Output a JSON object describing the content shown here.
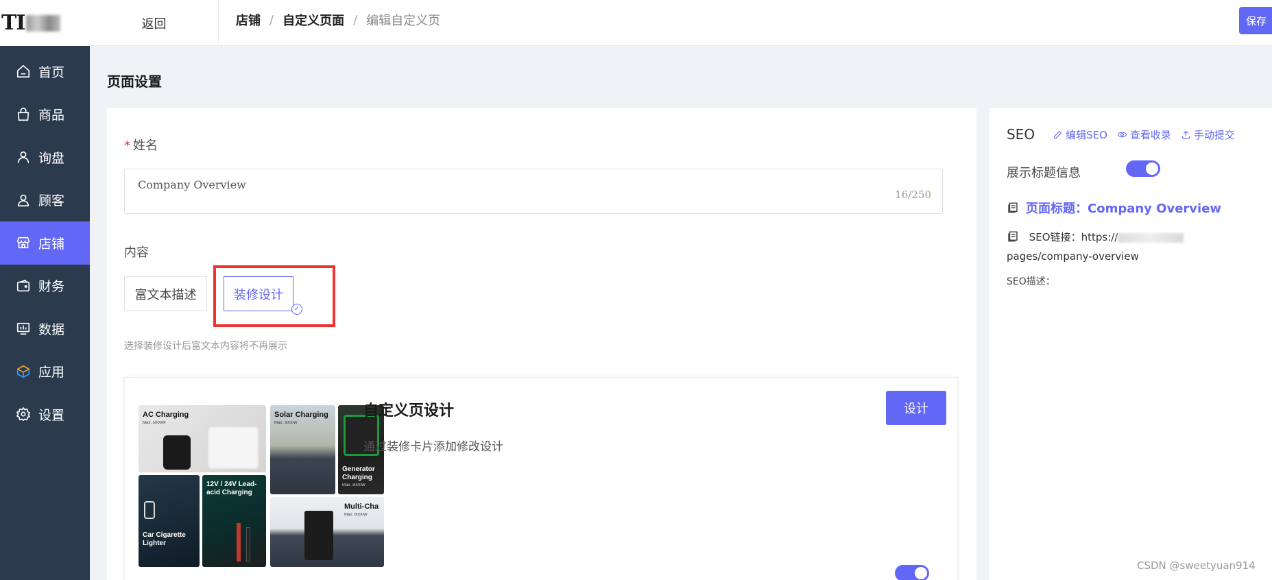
{
  "logo": {
    "text": "TI"
  },
  "nav": {
    "items": [
      {
        "label": "首页",
        "icon": "home-icon"
      },
      {
        "label": "商品",
        "icon": "shopping-bag-icon"
      },
      {
        "label": "询盘",
        "icon": "user-icon"
      },
      {
        "label": "顾客",
        "icon": "customer-icon"
      },
      {
        "label": "店铺",
        "icon": "store-icon",
        "active": true
      },
      {
        "label": "财务",
        "icon": "wallet-icon"
      },
      {
        "label": "数据",
        "icon": "monitor-chart-icon"
      },
      {
        "label": "应用",
        "icon": "cube-icon"
      },
      {
        "label": "设置",
        "icon": "gear-icon"
      }
    ]
  },
  "topbar": {
    "back_label": "返回",
    "breadcrumb": [
      "店铺",
      "自定义页面",
      "编辑自定义页"
    ],
    "save_label": "保存"
  },
  "page": {
    "title": "页面设置"
  },
  "form": {
    "name_label": "姓名",
    "name_value": "Company Overview",
    "name_count": "16/250",
    "content_label": "内容",
    "option_rich_text": "富文本描述",
    "option_design": "装修设计",
    "hint": "选择装修设计后富文本内容将不再展示"
  },
  "design_card": {
    "title": "自定义页设计",
    "description": "通过装修卡片添加修改设计",
    "design_button": "设计",
    "enabled": true,
    "tiles": {
      "ac": {
        "title": "AC Charging",
        "sub": "Max. 5000W"
      },
      "solar": {
        "title": "Solar Charging",
        "sub": "Max. 3000W"
      },
      "generator": {
        "title": "Generator Charging",
        "sub": "Max. 3000W"
      },
      "car": {
        "title": "Car Cigarette Lighter"
      },
      "lead": {
        "title": "12V / 24V Lead-acid Charging"
      },
      "multi": {
        "title": "Multi-Cha",
        "sub": "Max. 8000W"
      }
    }
  },
  "seo": {
    "title": "SEO",
    "edit_label": "编辑SEO",
    "view_label": "查看收录",
    "submit_label": "手动提交",
    "show_title_label": "展示标题信息",
    "show_title_enabled": true,
    "page_title_label": "页面标题：Company Overview",
    "url_prefix": "SEO链接：https://",
    "url_suffix": "pages/company-overview",
    "desc_label": "SEO描述："
  },
  "watermark": "CSDN @sweetyuan914",
  "colors": {
    "accent": "#6367f5",
    "sidebar": "#2c3a4e",
    "highlight": "#ee3333"
  }
}
